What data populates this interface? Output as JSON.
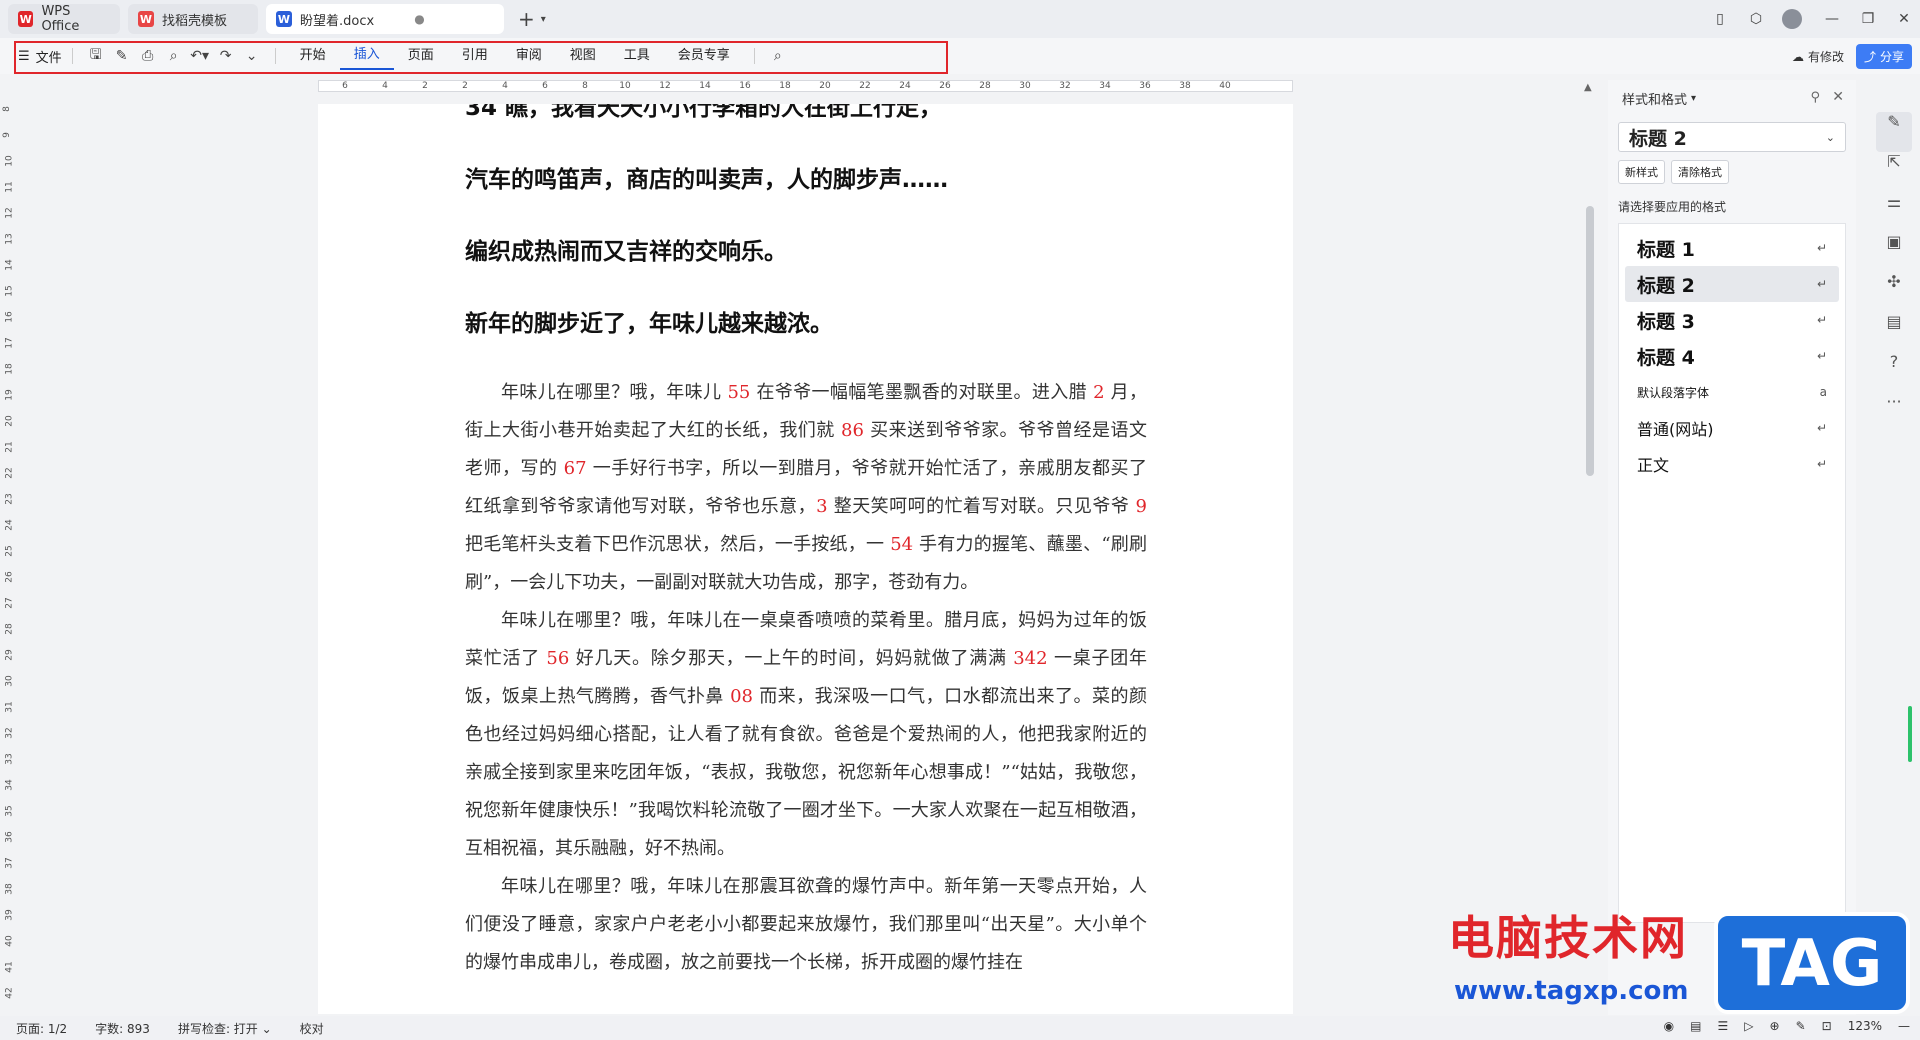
{
  "tabs": [
    {
      "label": "WPS Office",
      "icon": "wps-logo-icon",
      "color": "#e0262b"
    },
    {
      "label": "找稻壳模板",
      "icon": "docer-logo-icon",
      "color": "#e84545"
    },
    {
      "label": "盼望着.docx",
      "icon": "wps-writer-icon",
      "color": "#2b5fd9",
      "active": true
    }
  ],
  "toolbar": {
    "file_label": "文件",
    "menus": [
      "开始",
      "插入",
      "页面",
      "引用",
      "审阅",
      "视图",
      "工具",
      "会员专享"
    ],
    "active_menu": "插入",
    "revise_label": "有修改",
    "share_label": "分享"
  },
  "ruler_h": [
    "6",
    "4",
    "2",
    "2",
    "4",
    "6",
    "8",
    "10",
    "12",
    "14",
    "16",
    "18",
    "20",
    "22",
    "24",
    "26",
    "28",
    "30",
    "32",
    "34",
    "36",
    "38",
    "40"
  ],
  "ruler_v": [
    "8",
    "9",
    "10",
    "11",
    "12",
    "13",
    "14",
    "15",
    "16",
    "17",
    "18",
    "19",
    "20",
    "21",
    "22",
    "23",
    "24",
    "25",
    "26",
    "27",
    "28",
    "29",
    "30",
    "31",
    "32",
    "33",
    "34",
    "35",
    "36",
    "37",
    "38",
    "39",
    "40",
    "41",
    "42"
  ],
  "document": {
    "headings": [
      "34 瞧，我看天天小小行李箱的人在街上行走，",
      "汽车的鸣笛声，商店的叫卖声，人的脚步声……",
      "编织成热闹而又吉祥的交响乐。",
      "新年的脚步近了，年味儿越来越浓。"
    ],
    "paragraphs": [
      [
        {
          "t": "年味儿在哪里？哦，年味儿 "
        },
        {
          "t": "55",
          "num": true
        },
        {
          "t": " 在爷爷一幅幅笔墨飘香的对联里。进入腊 "
        },
        {
          "t": "2",
          "num": true
        },
        {
          "t": " 月，街上大街小巷开始卖起了大红的长纸，我们就 "
        },
        {
          "t": "86",
          "num": true
        },
        {
          "t": " 买来送到爷爷家。爷爷曾经是语文老师，写的 "
        },
        {
          "t": "67",
          "num": true
        },
        {
          "t": " 一手好行书字，所以一到腊月，爷爷就开始忙活了，亲戚朋友都买了红纸拿到爷爷家请他写对联，爷爷也乐意，"
        },
        {
          "t": "3",
          "num": true
        },
        {
          "t": " 整天笑呵呵的忙着写对联。只见爷爷 "
        },
        {
          "t": "9",
          "num": true
        },
        {
          "t": " 把毛笔杆头支着下巴作沉思状，然后，一手按纸，一 "
        },
        {
          "t": "54",
          "num": true
        },
        {
          "t": " 手有力的握笔、蘸墨、“刷刷刷”，一会儿下功夫，一副副对联就大功告成，那字，苍劲有力。"
        }
      ],
      [
        {
          "t": "年味儿在哪里？哦，年味儿在一桌桌香喷喷的菜肴里。腊月底，妈妈为过年的饭菜忙活了 "
        },
        {
          "t": "56",
          "num": true
        },
        {
          "t": " 好几天。除夕那天，一上午的时间，妈妈就做了满满 "
        },
        {
          "t": "342",
          "num": true
        },
        {
          "t": " 一桌子团年饭，饭桌上热气腾腾，香气扑鼻 "
        },
        {
          "t": "08",
          "num": true
        },
        {
          "t": " 而来，我深吸一口气，口水都流出来了。菜的颜色也经过妈妈细心搭配，让人看了就有食欲。爸爸是个爱热闹的人，他把我家附近的亲戚全接到家里来吃团年饭，“表叔，我敬您，祝您新年心想事成！”“姑姑，我敬您，祝您新年健康快乐！”我喝饮料轮流敬了一圈才坐下。一大家人欢聚在一起互相敬酒，互相祝福，其乐融融，好不热闹。"
        }
      ],
      [
        {
          "t": "年味儿在哪里？哦，年味儿在那震耳欲聋的爆竹声中。新年第一天零点开始，人们便没了睡意，家家户户老老小小都要起来放爆竹，我们那里叫“出天星”。大小单个的爆竹串成串儿，卷成圈，放之前要找一个长梯，拆开成圈的爆竹挂在"
        }
      ]
    ]
  },
  "styles_panel": {
    "title": "样式和格式",
    "current_style": "标题 2",
    "new_style_label": "新样式",
    "clear_format_label": "清除格式",
    "hint": "请选择要应用的格式",
    "styles": [
      {
        "label": "标题 1",
        "kind": "h",
        "enter": "↵"
      },
      {
        "label": "标题 2",
        "kind": "h",
        "enter": "↵",
        "selected": true
      },
      {
        "label": "标题 3",
        "kind": "h",
        "enter": "↵"
      },
      {
        "label": "标题 4",
        "kind": "h",
        "enter": "↵"
      },
      {
        "label": "默认段落字体",
        "kind": "s",
        "enter": "a"
      },
      {
        "label": "普通(网站)",
        "kind": "n",
        "enter": "↵"
      },
      {
        "label": "正文",
        "kind": "n",
        "enter": "↵"
      }
    ]
  },
  "statusbar": {
    "page": "页面: 1/2",
    "words": "字数: 893",
    "spell": "拼写检查: 打开 ⌄",
    "proof": "校对",
    "zoom": "123%"
  },
  "watermark": {
    "cn": "电脑技术网",
    "url": "www.tagxp.com",
    "tag": "TAG"
  }
}
